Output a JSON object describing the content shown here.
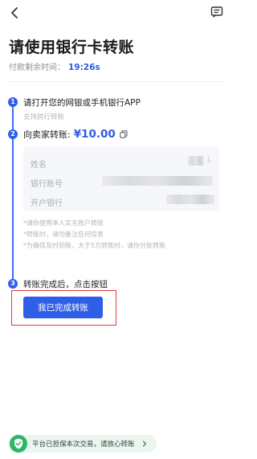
{
  "header": {
    "back_icon": "chevron-left-icon",
    "right_icon": "chat-icon"
  },
  "page": {
    "title": "请使用银行卡转账",
    "timer_label": "付款剩余时间：",
    "timer_value": "19:26s"
  },
  "steps": [
    {
      "num": "1",
      "text": "请打开您的网银或手机银行APP",
      "sub": "支持跨行转账"
    },
    {
      "num": "2",
      "text": "向卖家转账:",
      "amount": "¥10.00"
    },
    {
      "num": "3",
      "text": "转账完成后，点击按钮"
    }
  ],
  "account_info": {
    "fields": [
      {
        "label": "姓名",
        "value": "1"
      },
      {
        "label": "银行账号"
      },
      {
        "label": "开户银行"
      }
    ]
  },
  "notes": [
    "*请你使用本人实名账户转账",
    "*转账时，请勿备注任何信息",
    "*为确保及时到账，大于5万转账时，请你分批转账"
  ],
  "confirm_button": {
    "label": "我已完成转账"
  },
  "guarantee": {
    "text": "平台已担保本次交易，请放心转账",
    "icon": "shield-check-icon"
  },
  "colors": {
    "accent": "#2f5fe6",
    "highlight_border": "#e03b3b",
    "guarantee_bg": "#eaf6ee"
  }
}
